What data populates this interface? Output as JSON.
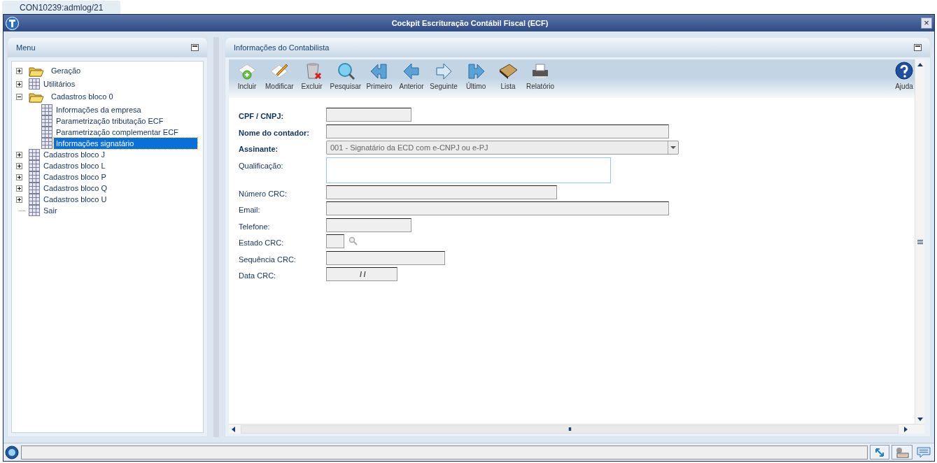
{
  "tab": {
    "label": "CON10239:admlog/21",
    "selected": true
  },
  "window": {
    "title": "Cockpit Escrituração Contábil Fiscal (ECF)",
    "close": "×"
  },
  "menu": {
    "title": "Menu",
    "items": [
      {
        "label": "Geração",
        "kind": "folder",
        "expanded": false,
        "selected": false
      },
      {
        "label": "Utilitários",
        "kind": "table",
        "expanded": false,
        "selected": false
      },
      {
        "label": "Cadastros bloco 0",
        "kind": "folder",
        "expanded": true,
        "selected": false,
        "children": [
          {
            "label": "Informações da empresa",
            "kind": "table",
            "selected": false
          },
          {
            "label": "Parametrização tributação ECF",
            "kind": "table",
            "selected": false
          },
          {
            "label": "Parametrização complementar ECF",
            "kind": "table",
            "selected": false
          },
          {
            "label": "Informações signatário",
            "kind": "table",
            "selected": true
          }
        ]
      },
      {
        "label": "Cadastros bloco J",
        "kind": "table",
        "expanded": false,
        "selected": false
      },
      {
        "label": "Cadastros bloco L",
        "kind": "table",
        "expanded": false,
        "selected": false
      },
      {
        "label": "Cadastros bloco P",
        "kind": "table",
        "expanded": false,
        "selected": false
      },
      {
        "label": "Cadastros bloco Q",
        "kind": "table",
        "expanded": false,
        "selected": false
      },
      {
        "label": "Cadastros bloco U",
        "kind": "table",
        "expanded": false,
        "selected": false
      },
      {
        "label": "Sair",
        "kind": "table",
        "selected": false
      }
    ]
  },
  "form": {
    "title": "Informações do Contabilista",
    "toolbar": [
      {
        "label": "Incluir",
        "kind": "add"
      },
      {
        "label": "Modificar",
        "kind": "edit"
      },
      {
        "label": "Excluir",
        "kind": "delete"
      },
      {
        "label": "Pesquisar",
        "kind": "search"
      },
      {
        "label": "Primeiro",
        "kind": "first"
      },
      {
        "label": "Anterior",
        "kind": "prev"
      },
      {
        "label": "Seguinte",
        "kind": "next"
      },
      {
        "label": "Último",
        "kind": "last"
      },
      {
        "label": "Lista",
        "kind": "book"
      },
      {
        "label": "Relatório",
        "kind": "print"
      }
    ],
    "help": {
      "label": "Ajuda"
    },
    "fields": [
      {
        "label": "CPF / CNPJ:",
        "required": true,
        "kind": "text"
      },
      {
        "label": "Nome do contador:",
        "required": true,
        "kind": "text"
      },
      {
        "label": "Assinante:",
        "required": true,
        "kind": "combo",
        "value": "001 - Signatário da ECD com e-CNPJ ou e-PJ"
      },
      {
        "label": "Qualificação:",
        "required": false,
        "kind": "textarea"
      },
      {
        "label": "Número CRC:",
        "required": false,
        "kind": "text"
      },
      {
        "label": "Email:",
        "required": false,
        "kind": "text"
      },
      {
        "label": "Telefone:",
        "required": false,
        "kind": "text"
      },
      {
        "label": "Estado CRC:",
        "required": false,
        "kind": "lookup"
      },
      {
        "label": "Sequência CRC:",
        "required": false,
        "kind": "text"
      },
      {
        "label": "Data CRC:",
        "required": false,
        "kind": "text",
        "value": " / /"
      }
    ]
  },
  "scrollbar_thumb": "III"
}
